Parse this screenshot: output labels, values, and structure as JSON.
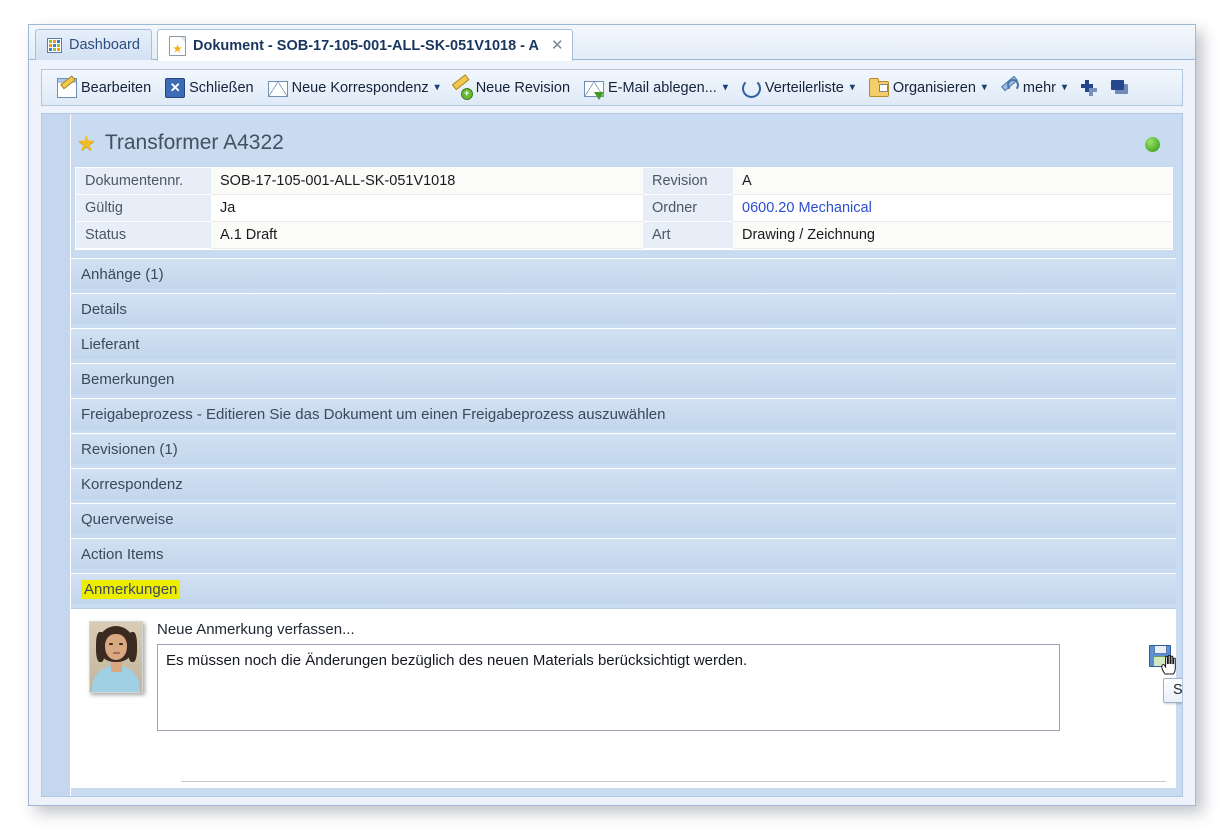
{
  "tabs": [
    {
      "id": "dashboard",
      "label": "Dashboard",
      "icon": "dashboard-grid-icon",
      "active": false
    },
    {
      "id": "document",
      "label": "Dokument - SOB-17-105-001-ALL-SK-051V1018 - A",
      "icon": "document-star-icon",
      "active": true,
      "close": "✕"
    }
  ],
  "toolbar": {
    "items": [
      {
        "id": "bearbeiten",
        "label": "Bearbeiten",
        "icon": "edit-pencil-icon",
        "caret": false
      },
      {
        "id": "schliessen",
        "label": "Schließen",
        "icon": "close-x-icon",
        "caret": false
      },
      {
        "id": "neue-korrespondenz",
        "label": "Neue Korrespondenz",
        "icon": "envelope-icon",
        "caret": true
      },
      {
        "id": "neue-revision",
        "label": "Neue Revision",
        "icon": "new-revision-icon",
        "caret": false
      },
      {
        "id": "email-ablegen",
        "label": "E-Mail ablegen...",
        "icon": "email-file-icon",
        "caret": true
      },
      {
        "id": "verteilerliste",
        "label": "Verteilerliste",
        "icon": "refresh-circle-icon",
        "caret": true
      },
      {
        "id": "organisieren",
        "label": "Organisieren",
        "icon": "folder-lock-icon",
        "caret": true
      },
      {
        "id": "mehr",
        "label": "mehr",
        "icon": "wrench-icon",
        "caret": true
      }
    ],
    "caret_glyph": "▾",
    "extra_icons": [
      {
        "id": "add-stack",
        "name": "add-plus-stack-icon"
      },
      {
        "id": "collapse-windows",
        "name": "window-stack-icon"
      }
    ]
  },
  "document": {
    "title": "Transformer A4322",
    "favorite_icon": "star-icon",
    "status_indicator": {
      "name": "status-dot-green",
      "color": "#4caf26"
    },
    "fields": [
      {
        "label": "Dokumentennr.",
        "value": "SOB-17-105-001-ALL-SK-051V1018",
        "label2": "Revision",
        "value2": "A",
        "link2": false
      },
      {
        "label": "Gültig",
        "value": "Ja",
        "label2": "Ordner",
        "value2": "0600.20 Mechanical",
        "link2": true
      },
      {
        "label": "Status",
        "value": "A.1 Draft",
        "label2": "Art",
        "value2": "Drawing / Zeichnung",
        "link2": false
      }
    ]
  },
  "sections": [
    {
      "id": "anhaenge",
      "label": "Anhänge (1)",
      "expanded": false,
      "toggle": "+",
      "highlight": false
    },
    {
      "id": "details",
      "label": "Details",
      "expanded": false,
      "toggle": "+",
      "highlight": false
    },
    {
      "id": "lieferant",
      "label": "Lieferant",
      "expanded": false,
      "toggle": "+",
      "highlight": false
    },
    {
      "id": "bemerkungen",
      "label": "Bemerkungen",
      "expanded": false,
      "toggle": "+",
      "highlight": false
    },
    {
      "id": "freigabeprozess",
      "label": "Freigabeprozess - Editieren Sie das Dokument um einen Freigabeprozess auszuwählen",
      "expanded": false,
      "toggle": "+",
      "highlight": false
    },
    {
      "id": "revisionen",
      "label": "Revisionen (1)",
      "expanded": false,
      "toggle": "+",
      "highlight": false
    },
    {
      "id": "korrespondenz",
      "label": "Korrespondenz",
      "expanded": false,
      "toggle": "+",
      "highlight": false
    },
    {
      "id": "querverweise",
      "label": "Querverweise",
      "expanded": false,
      "toggle": "+",
      "highlight": false
    },
    {
      "id": "action-items",
      "label": "Action Items",
      "expanded": false,
      "toggle": "+",
      "highlight": false
    },
    {
      "id": "anmerkungen",
      "label": "Anmerkungen",
      "expanded": true,
      "toggle": "−",
      "highlight": true
    }
  ],
  "annotation_panel": {
    "avatar_name": "user-avatar-photo",
    "prompt": "Neue Anmerkung verfassen...",
    "text_value": "Es müssen noch die Änderungen bezüglich des neuen Materials berücksichtigt werden.",
    "placeholder": "Neue Anmerkung verfassen...",
    "save": {
      "icon": "floppy-save-icon",
      "tooltip": "Speichern"
    }
  },
  "colors": {
    "accent_blue": "#2f5d9c",
    "panel_blue": "#c9dbf0",
    "highlight_yellow": "#eded00",
    "link_blue": "#2b4fd1",
    "status_green": "#4caf26"
  }
}
